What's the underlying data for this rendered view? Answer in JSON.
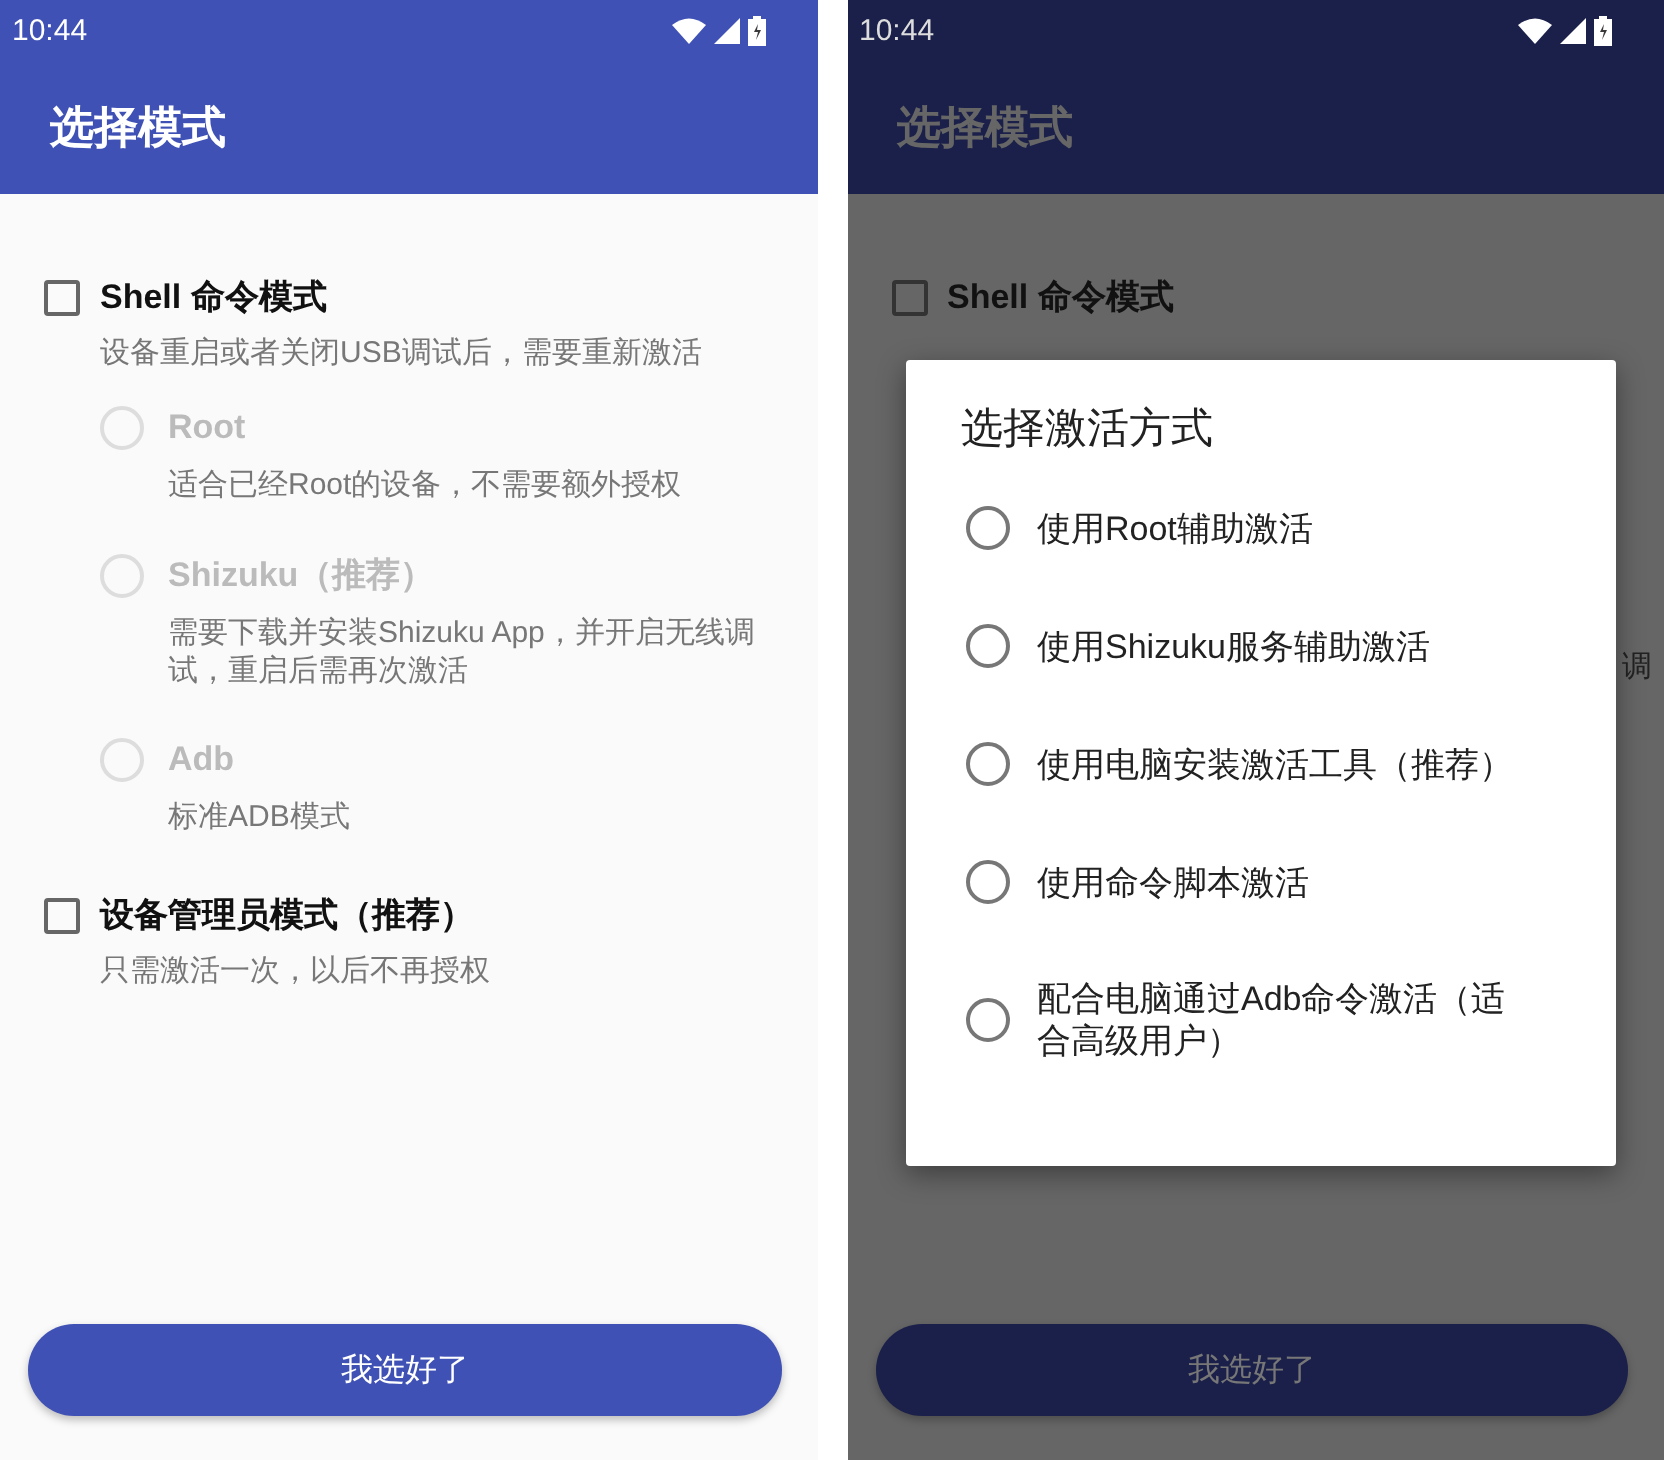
{
  "screens": [
    {
      "kind": "main",
      "status_bar": {
        "time": "10:44"
      },
      "app_bar": {
        "title": "选择模式"
      },
      "modes": [
        {
          "label": "Shell 命令模式",
          "checked": false,
          "description": "设备重启或者关闭USB调试后，需要重新激活",
          "options": [
            {
              "label": "Root",
              "description": "适合已经Root的设备，不需要额外授权",
              "selected": false,
              "disabled": true
            },
            {
              "label": "Shizuku（推荐）",
              "description": "需要下载并安装Shizuku App，并开启无线调试，重启后需再次激活",
              "selected": false,
              "disabled": true
            },
            {
              "label": "Adb",
              "description": "标准ADB模式",
              "selected": false,
              "disabled": true
            }
          ]
        },
        {
          "label": "设备管理员模式（推荐）",
          "checked": false,
          "description": "只需激活一次，以后不再授权"
        }
      ],
      "button": "我选好了"
    },
    {
      "kind": "dialog",
      "status_bar": {
        "time": "10:44"
      },
      "app_bar": {
        "title": "选择模式"
      },
      "background": {
        "mode_label": "Shell 命令模式",
        "mode_checked": false,
        "fragment": "调"
      },
      "dialog": {
        "title": "选择激活方式",
        "options": [
          {
            "label": "使用Root辅助激活",
            "selected": false
          },
          {
            "label": "使用Shizuku服务辅助激活",
            "selected": false
          },
          {
            "label": "使用电脑安装激活工具（推荐）",
            "selected": false
          },
          {
            "label": "使用命令脚本激活",
            "selected": false
          },
          {
            "label": "配合电脑通过Adb命令激活（适合高级用户）",
            "selected": false
          }
        ]
      },
      "button": "我选好了"
    }
  ]
}
